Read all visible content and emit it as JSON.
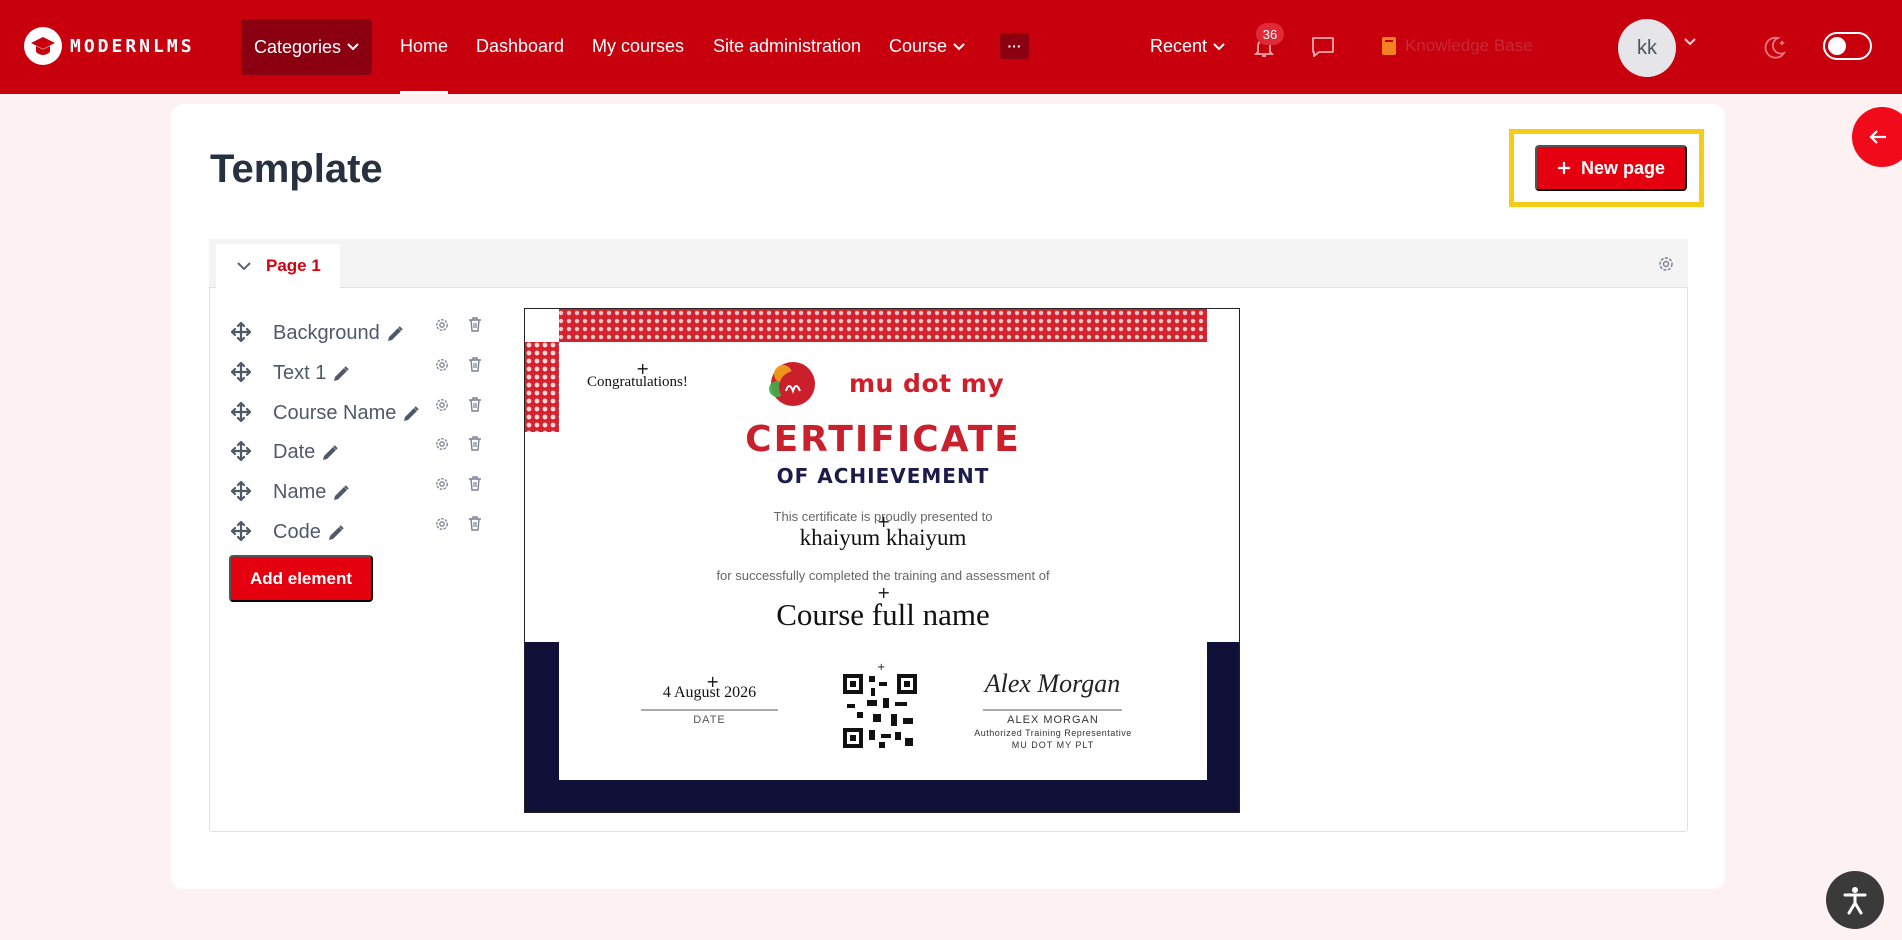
{
  "colors": {
    "nav_bg": "#c8000e",
    "accent": "#e4000f",
    "highlight": "#f7cc17",
    "cert_navy": "#111038"
  },
  "nav": {
    "brand": "MODERNLMS",
    "categories": "Categories",
    "links": [
      "Home",
      "Dashboard",
      "My courses",
      "Site administration"
    ],
    "course": "Course",
    "more": "···",
    "recent": "Recent",
    "notifications_count": "36",
    "knowledge_base": "Knowledge Base",
    "avatar": "kk"
  },
  "page": {
    "title": "Template",
    "new_page": "New page"
  },
  "panel": {
    "page_label": "Page 1",
    "add_element": "Add element"
  },
  "elements": [
    {
      "label": "Background"
    },
    {
      "label": "Text 1"
    },
    {
      "label": "Course Name"
    },
    {
      "label": "Date"
    },
    {
      "label": "Name"
    },
    {
      "label": "Code"
    }
  ],
  "certificate": {
    "congrats": "Congratulations!",
    "brand": "mu dot my",
    "title": "CERTIFICATE",
    "subtitle": "OF ACHIEVEMENT",
    "presented": "This certificate is proudly presented to",
    "recipient": "khaiyum khaiyum",
    "completed": "for successfully completed the training and assessment of",
    "course": "Course full name",
    "date": "4 August 2026",
    "date_label": "DATE",
    "signature": "Alex Morgan",
    "signer": "ALEX MORGAN",
    "signer_role": "Authorized Training Representative",
    "signer_org": "MU DOT MY PLT"
  },
  "icons": [
    "graduation-cap-icon",
    "chevron-down-icon",
    "bell-icon",
    "chat-icon",
    "book-icon",
    "moon-icon",
    "arrow-left-icon",
    "plus-icon",
    "gear-icon",
    "trash-icon",
    "move-icon",
    "pencil-icon",
    "accessibility-icon"
  ]
}
